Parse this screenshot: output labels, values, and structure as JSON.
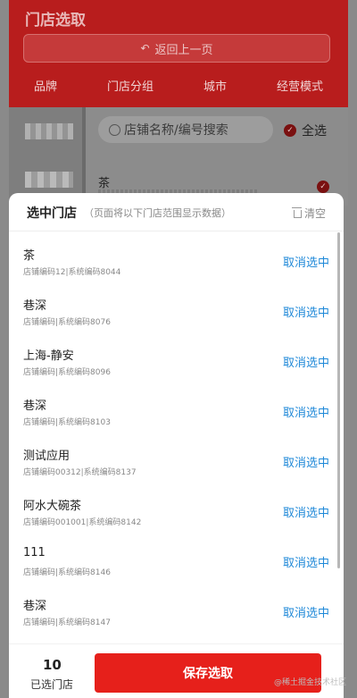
{
  "header": {
    "title": "门店选取",
    "back_label": "返回上一页",
    "tabs": [
      {
        "label": "品牌",
        "active": true
      },
      {
        "label": "门店分组",
        "active": false
      },
      {
        "label": "城市",
        "active": false
      },
      {
        "label": "经营模式",
        "active": false
      }
    ]
  },
  "filter": {
    "search_placeholder": "店铺名称/编号搜索",
    "select_all_label": "全选",
    "peek_store_name": "茶"
  },
  "panel": {
    "title": "选中门店",
    "note": "（页面将以下门店范围显示数据）",
    "clear_label": "清空",
    "items": [
      {
        "name": "茶",
        "sub": "店铺编码12|系统编码8044",
        "action": "取消选中"
      },
      {
        "name": "巷深",
        "sub": "店铺编码|系统编码8076",
        "action": "取消选中"
      },
      {
        "name": "上海-静安",
        "sub": "店铺编码|系统编码8096",
        "action": "取消选中"
      },
      {
        "name": "巷深",
        "sub": "店铺编码|系统编码8103",
        "action": "取消选中"
      },
      {
        "name": "测试应用",
        "sub": "店铺编码00312|系统编码8137",
        "action": "取消选中"
      },
      {
        "name": "阿水大碗茶",
        "sub": "店铺编码001001|系统编码8142",
        "action": "取消选中"
      },
      {
        "name": "111",
        "sub": "店铺编码|系统编码8146",
        "action": "取消选中"
      },
      {
        "name": "巷深",
        "sub": "店铺编码|系统编码8147",
        "action": "取消选中"
      }
    ]
  },
  "footer": {
    "count": "10",
    "count_label": "已选门店",
    "save_label": "保存选取"
  },
  "watermark": "@稀土掘金技术社区",
  "colors": {
    "brand_red": "#e6201b",
    "header_red": "#b81d1d",
    "link_blue": "#1e88d8"
  }
}
